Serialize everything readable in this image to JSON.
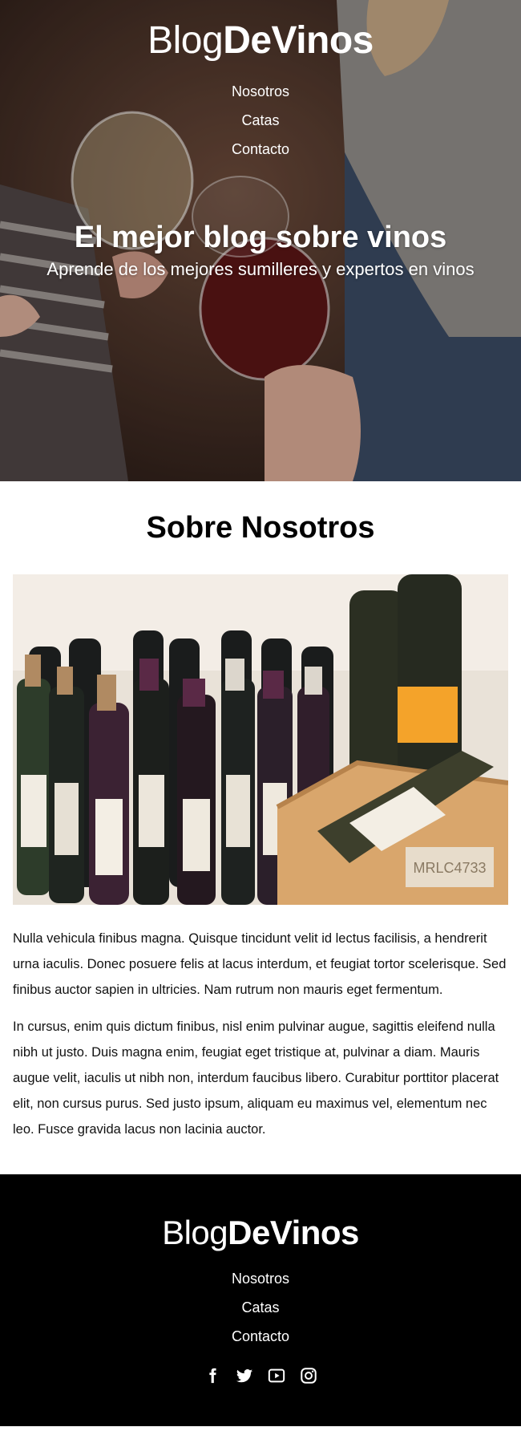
{
  "brand": {
    "part1": "Blog",
    "part2": "DeVinos"
  },
  "nav": [
    "Nosotros",
    "Catas",
    "Contacto"
  ],
  "hero": {
    "title": "El mejor blog sobre vinos",
    "subtitle": "Aprende de los mejores sumilleres y expertos en vinos"
  },
  "about": {
    "title": "Sobre Nosotros",
    "image_label": "MRLC4733",
    "paragraphs": [
      "Nulla vehicula finibus magna. Quisque tincidunt velit id lectus facilisis, a hendrerit urna iaculis. Donec posuere felis at lacus interdum, et feugiat tortor scelerisque. Sed finibus auctor sapien in ultricies. Nam rutrum non mauris eget fermentum.",
      "In cursus, enim quis dictum finibus, nisl enim pulvinar augue, sagittis eleifend nulla nibh ut justo. Duis magna enim, feugiat eget tristique at, pulvinar a diam. Mauris augue velit, iaculis ut nibh non, interdum faucibus libero. Curabitur porttitor placerat elit, non cursus purus. Sed justo ipsum, aliquam eu maximus vel, elementum nec leo. Fusce gravida lacus non lacinia auctor."
    ]
  },
  "footer": {
    "social": [
      "facebook-icon",
      "twitter-icon",
      "youtube-icon",
      "instagram-icon"
    ]
  },
  "colors": {
    "footer_bg": "#000000",
    "text": "#111111",
    "hero_text": "#ffffff"
  }
}
